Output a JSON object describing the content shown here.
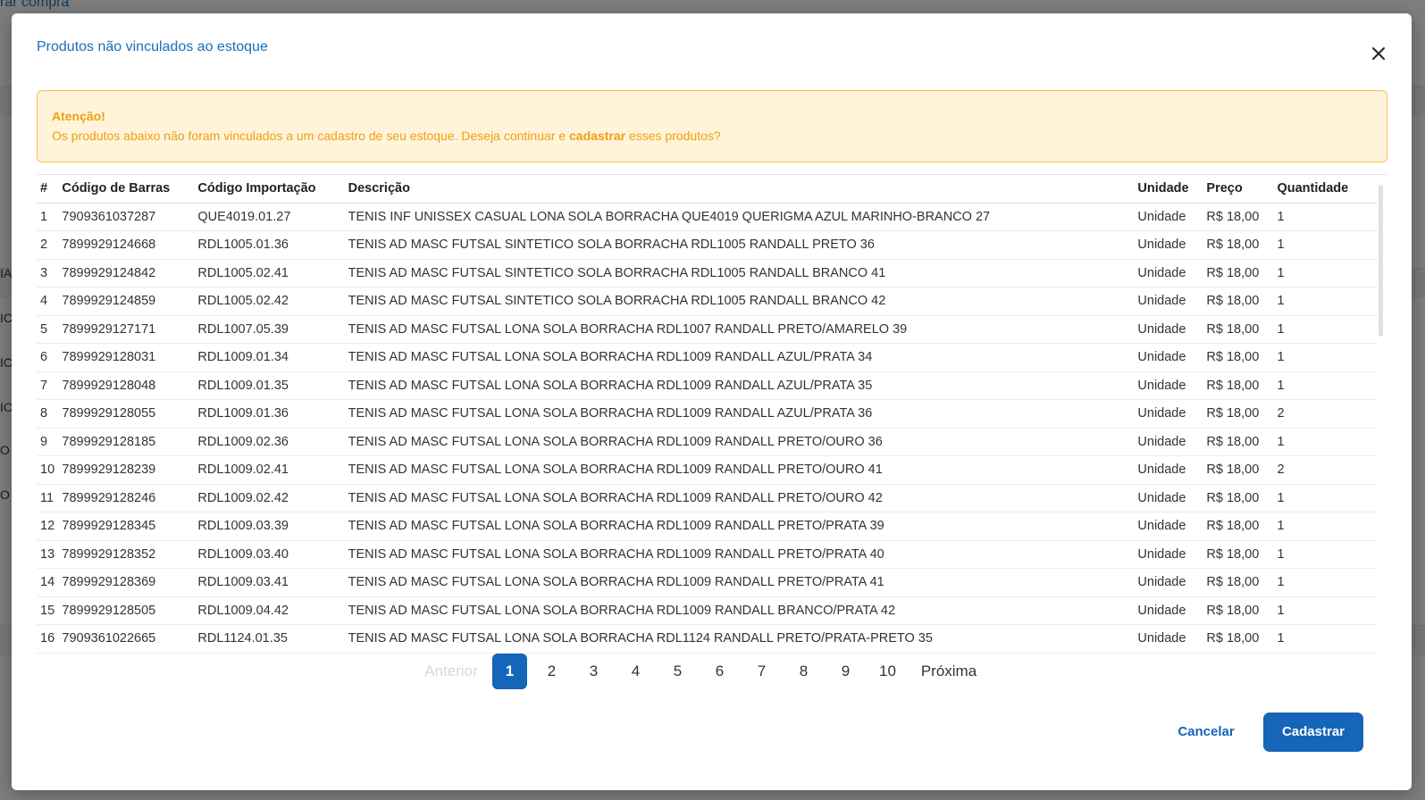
{
  "background": {
    "title_fragment": "rar compra",
    "left_fragments": [
      "IA",
      "IC",
      "IC",
      "IC",
      "O",
      "O"
    ]
  },
  "modal": {
    "title": "Produtos não vinculados ao estoque",
    "close_icon": "close-icon"
  },
  "alert": {
    "title": "Atenção!",
    "text_before": "Os produtos abaixo não foram vinculados a um cadastro de seu estoque. Deseja continuar e ",
    "text_bold": "cadastrar",
    "text_after": " esses produtos?"
  },
  "table": {
    "headers": [
      "#",
      "Código de Barras",
      "Código Importação",
      "Descrição",
      "Unidade",
      "Preço",
      "Quantidade"
    ],
    "rows": [
      [
        "1",
        "7909361037287",
        "QUE4019.01.27",
        "TENIS INF UNISSEX CASUAL LONA SOLA BORRACHA QUE4019 QUERIGMA AZUL MARINHO-BRANCO 27",
        "Unidade",
        "R$ 18,00",
        "1"
      ],
      [
        "2",
        "7899929124668",
        "RDL1005.01.36",
        "TENIS AD MASC FUTSAL SINTETICO SOLA BORRACHA RDL1005 RANDALL PRETO 36",
        "Unidade",
        "R$ 18,00",
        "1"
      ],
      [
        "3",
        "7899929124842",
        "RDL1005.02.41",
        "TENIS AD MASC FUTSAL SINTETICO SOLA BORRACHA RDL1005 RANDALL BRANCO 41",
        "Unidade",
        "R$ 18,00",
        "1"
      ],
      [
        "4",
        "7899929124859",
        "RDL1005.02.42",
        "TENIS AD MASC FUTSAL SINTETICO SOLA BORRACHA RDL1005 RANDALL BRANCO 42",
        "Unidade",
        "R$ 18,00",
        "1"
      ],
      [
        "5",
        "7899929127171",
        "RDL1007.05.39",
        "TENIS AD MASC FUTSAL LONA SOLA BORRACHA RDL1007 RANDALL PRETO/AMARELO 39",
        "Unidade",
        "R$ 18,00",
        "1"
      ],
      [
        "6",
        "7899929128031",
        "RDL1009.01.34",
        "TENIS AD MASC FUTSAL LONA SOLA BORRACHA RDL1009 RANDALL AZUL/PRATA 34",
        "Unidade",
        "R$ 18,00",
        "1"
      ],
      [
        "7",
        "7899929128048",
        "RDL1009.01.35",
        "TENIS AD MASC FUTSAL LONA SOLA BORRACHA RDL1009 RANDALL AZUL/PRATA 35",
        "Unidade",
        "R$ 18,00",
        "1"
      ],
      [
        "8",
        "7899929128055",
        "RDL1009.01.36",
        "TENIS AD MASC FUTSAL LONA SOLA BORRACHA RDL1009 RANDALL AZUL/PRATA 36",
        "Unidade",
        "R$ 18,00",
        "2"
      ],
      [
        "9",
        "7899929128185",
        "RDL1009.02.36",
        "TENIS AD MASC FUTSAL LONA SOLA BORRACHA RDL1009 RANDALL PRETO/OURO 36",
        "Unidade",
        "R$ 18,00",
        "1"
      ],
      [
        "10",
        "7899929128239",
        "RDL1009.02.41",
        "TENIS AD MASC FUTSAL LONA SOLA BORRACHA RDL1009 RANDALL PRETO/OURO 41",
        "Unidade",
        "R$ 18,00",
        "2"
      ],
      [
        "11",
        "7899929128246",
        "RDL1009.02.42",
        "TENIS AD MASC FUTSAL LONA SOLA BORRACHA RDL1009 RANDALL PRETO/OURO 42",
        "Unidade",
        "R$ 18,00",
        "1"
      ],
      [
        "12",
        "7899929128345",
        "RDL1009.03.39",
        "TENIS AD MASC FUTSAL LONA SOLA BORRACHA RDL1009 RANDALL PRETO/PRATA 39",
        "Unidade",
        "R$ 18,00",
        "1"
      ],
      [
        "13",
        "7899929128352",
        "RDL1009.03.40",
        "TENIS AD MASC FUTSAL LONA SOLA BORRACHA RDL1009 RANDALL PRETO/PRATA 40",
        "Unidade",
        "R$ 18,00",
        "1"
      ],
      [
        "14",
        "7899929128369",
        "RDL1009.03.41",
        "TENIS AD MASC FUTSAL LONA SOLA BORRACHA RDL1009 RANDALL PRETO/PRATA 41",
        "Unidade",
        "R$ 18,00",
        "1"
      ],
      [
        "15",
        "7899929128505",
        "RDL1009.04.42",
        "TENIS AD MASC FUTSAL LONA SOLA BORRACHA RDL1009 RANDALL BRANCO/PRATA 42",
        "Unidade",
        "R$ 18,00",
        "1"
      ],
      [
        "16",
        "7909361022665",
        "RDL1124.01.35",
        "TENIS AD MASC FUTSAL LONA SOLA BORRACHA RDL1124 RANDALL PRETO/PRATA-PRETO 35",
        "Unidade",
        "R$ 18,00",
        "1"
      ]
    ]
  },
  "pagination": {
    "prev_label": "Anterior",
    "pages": [
      "1",
      "2",
      "3",
      "4",
      "5",
      "6",
      "7",
      "8",
      "9",
      "10"
    ],
    "active_page": "1",
    "next_label": "Próxima"
  },
  "footer": {
    "cancel_label": "Cancelar",
    "submit_label": "Cadastrar"
  },
  "colors": {
    "primary": "#1565b8",
    "warning_text": "#ee9f10",
    "warning_bg": "#fff3d9",
    "warning_border": "#f7c04a"
  }
}
